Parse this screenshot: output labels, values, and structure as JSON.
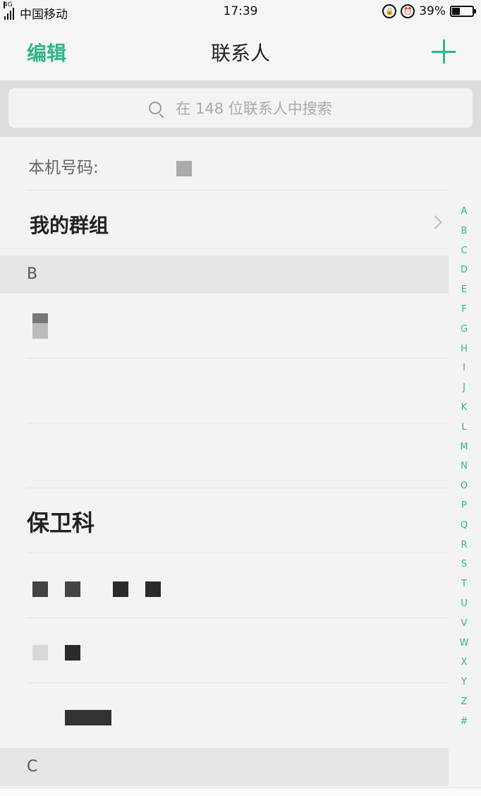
{
  "status_bar": {
    "network": "4G",
    "carrier": "中国移动",
    "time": "17:39",
    "battery": "39%",
    "battery_level": 0.39
  },
  "nav": {
    "edit_label": "编辑",
    "title": "联系人",
    "add_icon": "plus-icon"
  },
  "search": {
    "placeholder": "在 148 位联系人中搜索",
    "icon": "search-icon"
  },
  "my_number": {
    "label": "本机号码:"
  },
  "groups": {
    "label": "我的群组",
    "chevron_icon": "chevron-right-icon"
  },
  "sections": [
    {
      "letter": "B"
    },
    {
      "letter": "C"
    }
  ],
  "contacts": [
    {
      "name": ""
    },
    {
      "name": ""
    },
    {
      "name": "保卫科"
    },
    {
      "name": ""
    },
    {
      "name": ""
    },
    {
      "name": ""
    }
  ],
  "index_letters": [
    "A",
    "B",
    "C",
    "D",
    "E",
    "F",
    "G",
    "H",
    "I",
    "J",
    "K",
    "L",
    "M",
    "N",
    "O",
    "P",
    "Q",
    "R",
    "S",
    "T",
    "U",
    "V",
    "W",
    "X",
    "Y",
    "Z",
    "#"
  ],
  "colors": {
    "accent": "#2fb58a",
    "background": "#f3f3f3",
    "section_header": "#e6e6e8"
  }
}
